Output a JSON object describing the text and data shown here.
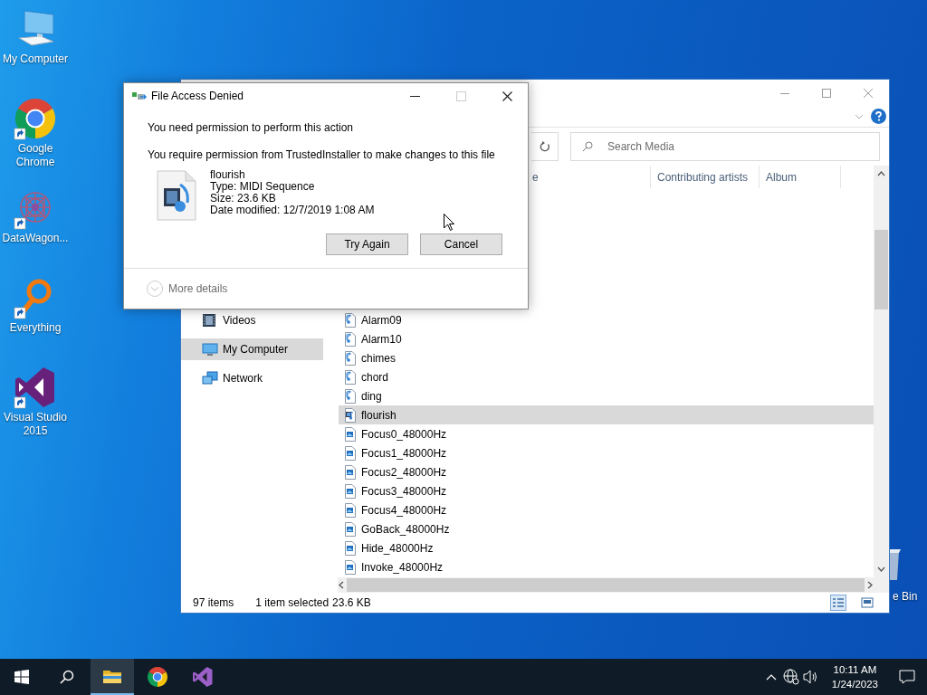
{
  "desktop_icons": [
    {
      "label": "My Computer",
      "kind": "computer",
      "shortcut": false
    },
    {
      "label": "Google Chrome",
      "kind": "chrome",
      "shortcut": true
    },
    {
      "label": "DataWagon...",
      "kind": "datawagon",
      "shortcut": true
    },
    {
      "label": "Everything",
      "kind": "everything",
      "shortcut": true
    },
    {
      "label": "Visual Studio 2015",
      "kind": "vs",
      "shortcut": true
    }
  ],
  "recycle_bin": {
    "label": "e Bin"
  },
  "explorer": {
    "search": {
      "placeholder": "Search Media"
    },
    "columns": [
      "e",
      "Contributing artists",
      "Album"
    ],
    "nav_items": [
      {
        "label": "Videos",
        "kind": "videos",
        "selected": false
      },
      {
        "label": "My Computer",
        "kind": "computer",
        "selected": true
      },
      {
        "label": "Network",
        "kind": "network",
        "selected": false
      }
    ],
    "files": [
      {
        "name": "Alarm09",
        "kind": "audio",
        "selected": false
      },
      {
        "name": "Alarm10",
        "kind": "audio",
        "selected": false
      },
      {
        "name": "chimes",
        "kind": "audio",
        "selected": false
      },
      {
        "name": "chord",
        "kind": "audio",
        "selected": false
      },
      {
        "name": "ding",
        "kind": "audio",
        "selected": false
      },
      {
        "name": "flourish",
        "kind": "midi",
        "selected": true
      },
      {
        "name": "Focus0_48000Hz",
        "kind": "wave",
        "selected": false
      },
      {
        "name": "Focus1_48000Hz",
        "kind": "wave",
        "selected": false
      },
      {
        "name": "Focus2_48000Hz",
        "kind": "wave",
        "selected": false
      },
      {
        "name": "Focus3_48000Hz",
        "kind": "wave",
        "selected": false
      },
      {
        "name": "Focus4_48000Hz",
        "kind": "wave",
        "selected": false
      },
      {
        "name": "GoBack_48000Hz",
        "kind": "wave",
        "selected": false
      },
      {
        "name": "Hide_48000Hz",
        "kind": "wave",
        "selected": false
      },
      {
        "name": "Invoke_48000Hz",
        "kind": "wave",
        "selected": false
      }
    ],
    "status_bar": {
      "item_count": "97 items",
      "selection": "1 item selected",
      "size": "23.6 KB"
    },
    "views": [
      {
        "kind": "details",
        "selected": true
      },
      {
        "kind": "tiles",
        "selected": false
      }
    ]
  },
  "dialog": {
    "title": "File Access Denied",
    "controls": [
      {
        "kind": "minimize",
        "disabled": false
      },
      {
        "kind": "maximize",
        "disabled": true
      },
      {
        "kind": "close",
        "disabled": false
      }
    ],
    "heading": "You need permission to perform this action",
    "message": "You require permission from TrustedInstaller to make changes to this file",
    "file": {
      "name": "flourish",
      "type": "Type: MIDI Sequence",
      "size": "Size: 23.6 KB",
      "date": "Date modified: 12/7/2019 1:08 AM"
    },
    "buttons": [
      "Try Again",
      "Cancel"
    ],
    "more_details": "More details"
  },
  "taskbar": {
    "items": [
      {
        "kind": "start",
        "selected": false
      },
      {
        "kind": "search",
        "selected": false
      },
      {
        "kind": "explorer",
        "selected": true
      },
      {
        "kind": "chrome",
        "selected": false
      },
      {
        "kind": "vs",
        "selected": false
      }
    ],
    "clock": {
      "time": "10:11 AM",
      "date": "1/24/2023"
    }
  }
}
